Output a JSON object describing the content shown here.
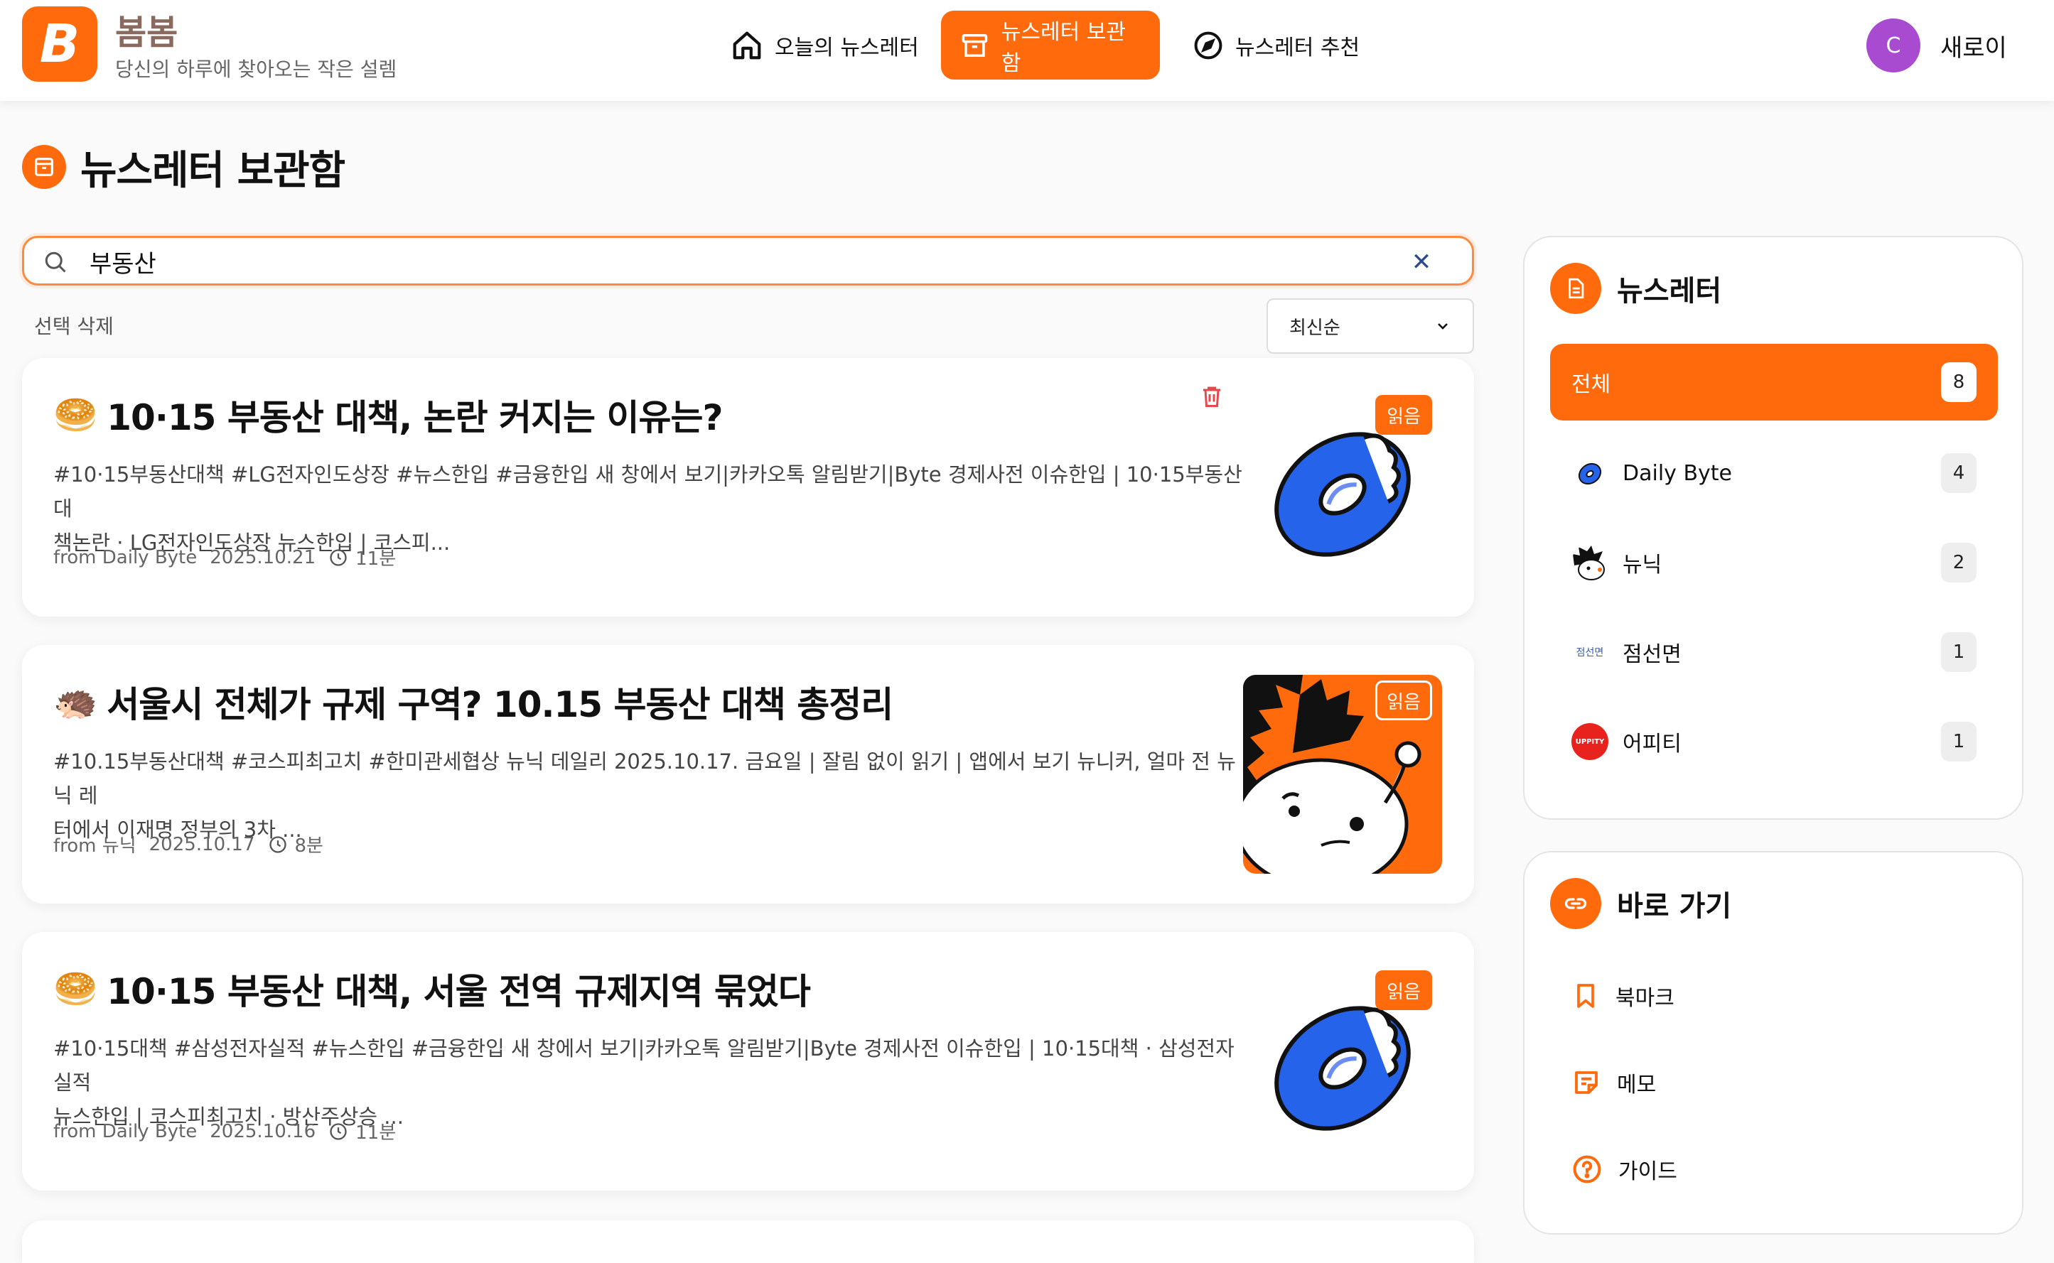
{
  "header": {
    "logo_letter": "B",
    "brand_name": "봄봄",
    "tagline": "당신의 하루에 찾아오는 작은 설렘",
    "nav": [
      {
        "label": "오늘의 뉴스레터",
        "icon": "home-icon",
        "active": false
      },
      {
        "label": "뉴스레터 보관함",
        "icon": "archive-icon",
        "active": true
      },
      {
        "label": "뉴스레터 추천",
        "icon": "compass-icon",
        "active": false
      }
    ],
    "user": {
      "initial": "C",
      "name": "새로이",
      "avatar_color": "#a84bd1"
    }
  },
  "page": {
    "title": "뉴스레터 보관함",
    "search_value": "부동산",
    "select_delete_label": "선택 삭제",
    "sort_value": "최신순"
  },
  "cards": [
    {
      "emoji": "🥯",
      "title": "10·15 부동산 대책, 논란 커지는 이유는?",
      "desc_line1": "#10·15부동산대책 #LG전자인도상장 #뉴스한입 #금융한입 새 창에서 보기|카카오톡 알림받기|Byte 경제사전 이슈한입 | 10·15부동산대",
      "desc_line2": "책논란 · LG전자인도상장 뉴스한입 | 코스피...",
      "source": "from Daily Byte",
      "date": "2025.10.21",
      "read_time": "11분",
      "badge": "읽음"
    },
    {
      "emoji": "🦔",
      "title": "서울시 전체가 규제 구역? 10.15 부동산 대책 총정리",
      "desc_line1": "#10.15부동산대책 #코스피최고치 #한미관세협상 뉴닉 데일리 2025.10.17. 금요일 | 잘림 없이 읽기 | 앱에서 보기 뉴니커, 얼마 전 뉴닉 레",
      "desc_line2": "터에서 이재명 정부의 3차 ...",
      "source": "from 뉴닉",
      "date": "2025.10.17",
      "read_time": "8분",
      "badge": "읽음"
    },
    {
      "emoji": "🥯",
      "title": "10·15 부동산 대책, 서울 전역 규제지역 묶었다",
      "desc_line1": "#10·15대책 #삼성전자실적 #뉴스한입 #금융한입 새 창에서 보기|카카오톡 알림받기|Byte 경제사전 이슈한입 | 10·15대책 · 삼성전자실적",
      "desc_line2": "뉴스한입 | 코스피최고치 · 방산주상승 ...",
      "source": "from Daily Byte",
      "date": "2025.10.16",
      "read_time": "11분",
      "badge": "읽음"
    }
  ],
  "sidebar": {
    "newsletters_title": "뉴스레터",
    "newsletters": [
      {
        "label": "전체",
        "count": "8",
        "active": true
      },
      {
        "label": "Daily Byte",
        "count": "4",
        "logo": "donut-logo"
      },
      {
        "label": "뉴닉",
        "count": "2",
        "logo": "hedgehog-logo"
      },
      {
        "label": "점선면",
        "count": "1",
        "logo": "jumseonmyeon-logo",
        "logo_text": "점선면"
      },
      {
        "label": "어피티",
        "count": "1",
        "logo": "uppity-logo",
        "logo_text": "UPPITY"
      }
    ],
    "shortcuts_title": "바로 가기",
    "shortcuts": [
      {
        "label": "북마크",
        "icon": "bookmark-icon"
      },
      {
        "label": "메모",
        "icon": "memo-icon"
      },
      {
        "label": "가이드",
        "icon": "help-icon"
      }
    ]
  },
  "colors": {
    "accent": "#ff6a0d",
    "brand_text": "#8a6a5e"
  }
}
